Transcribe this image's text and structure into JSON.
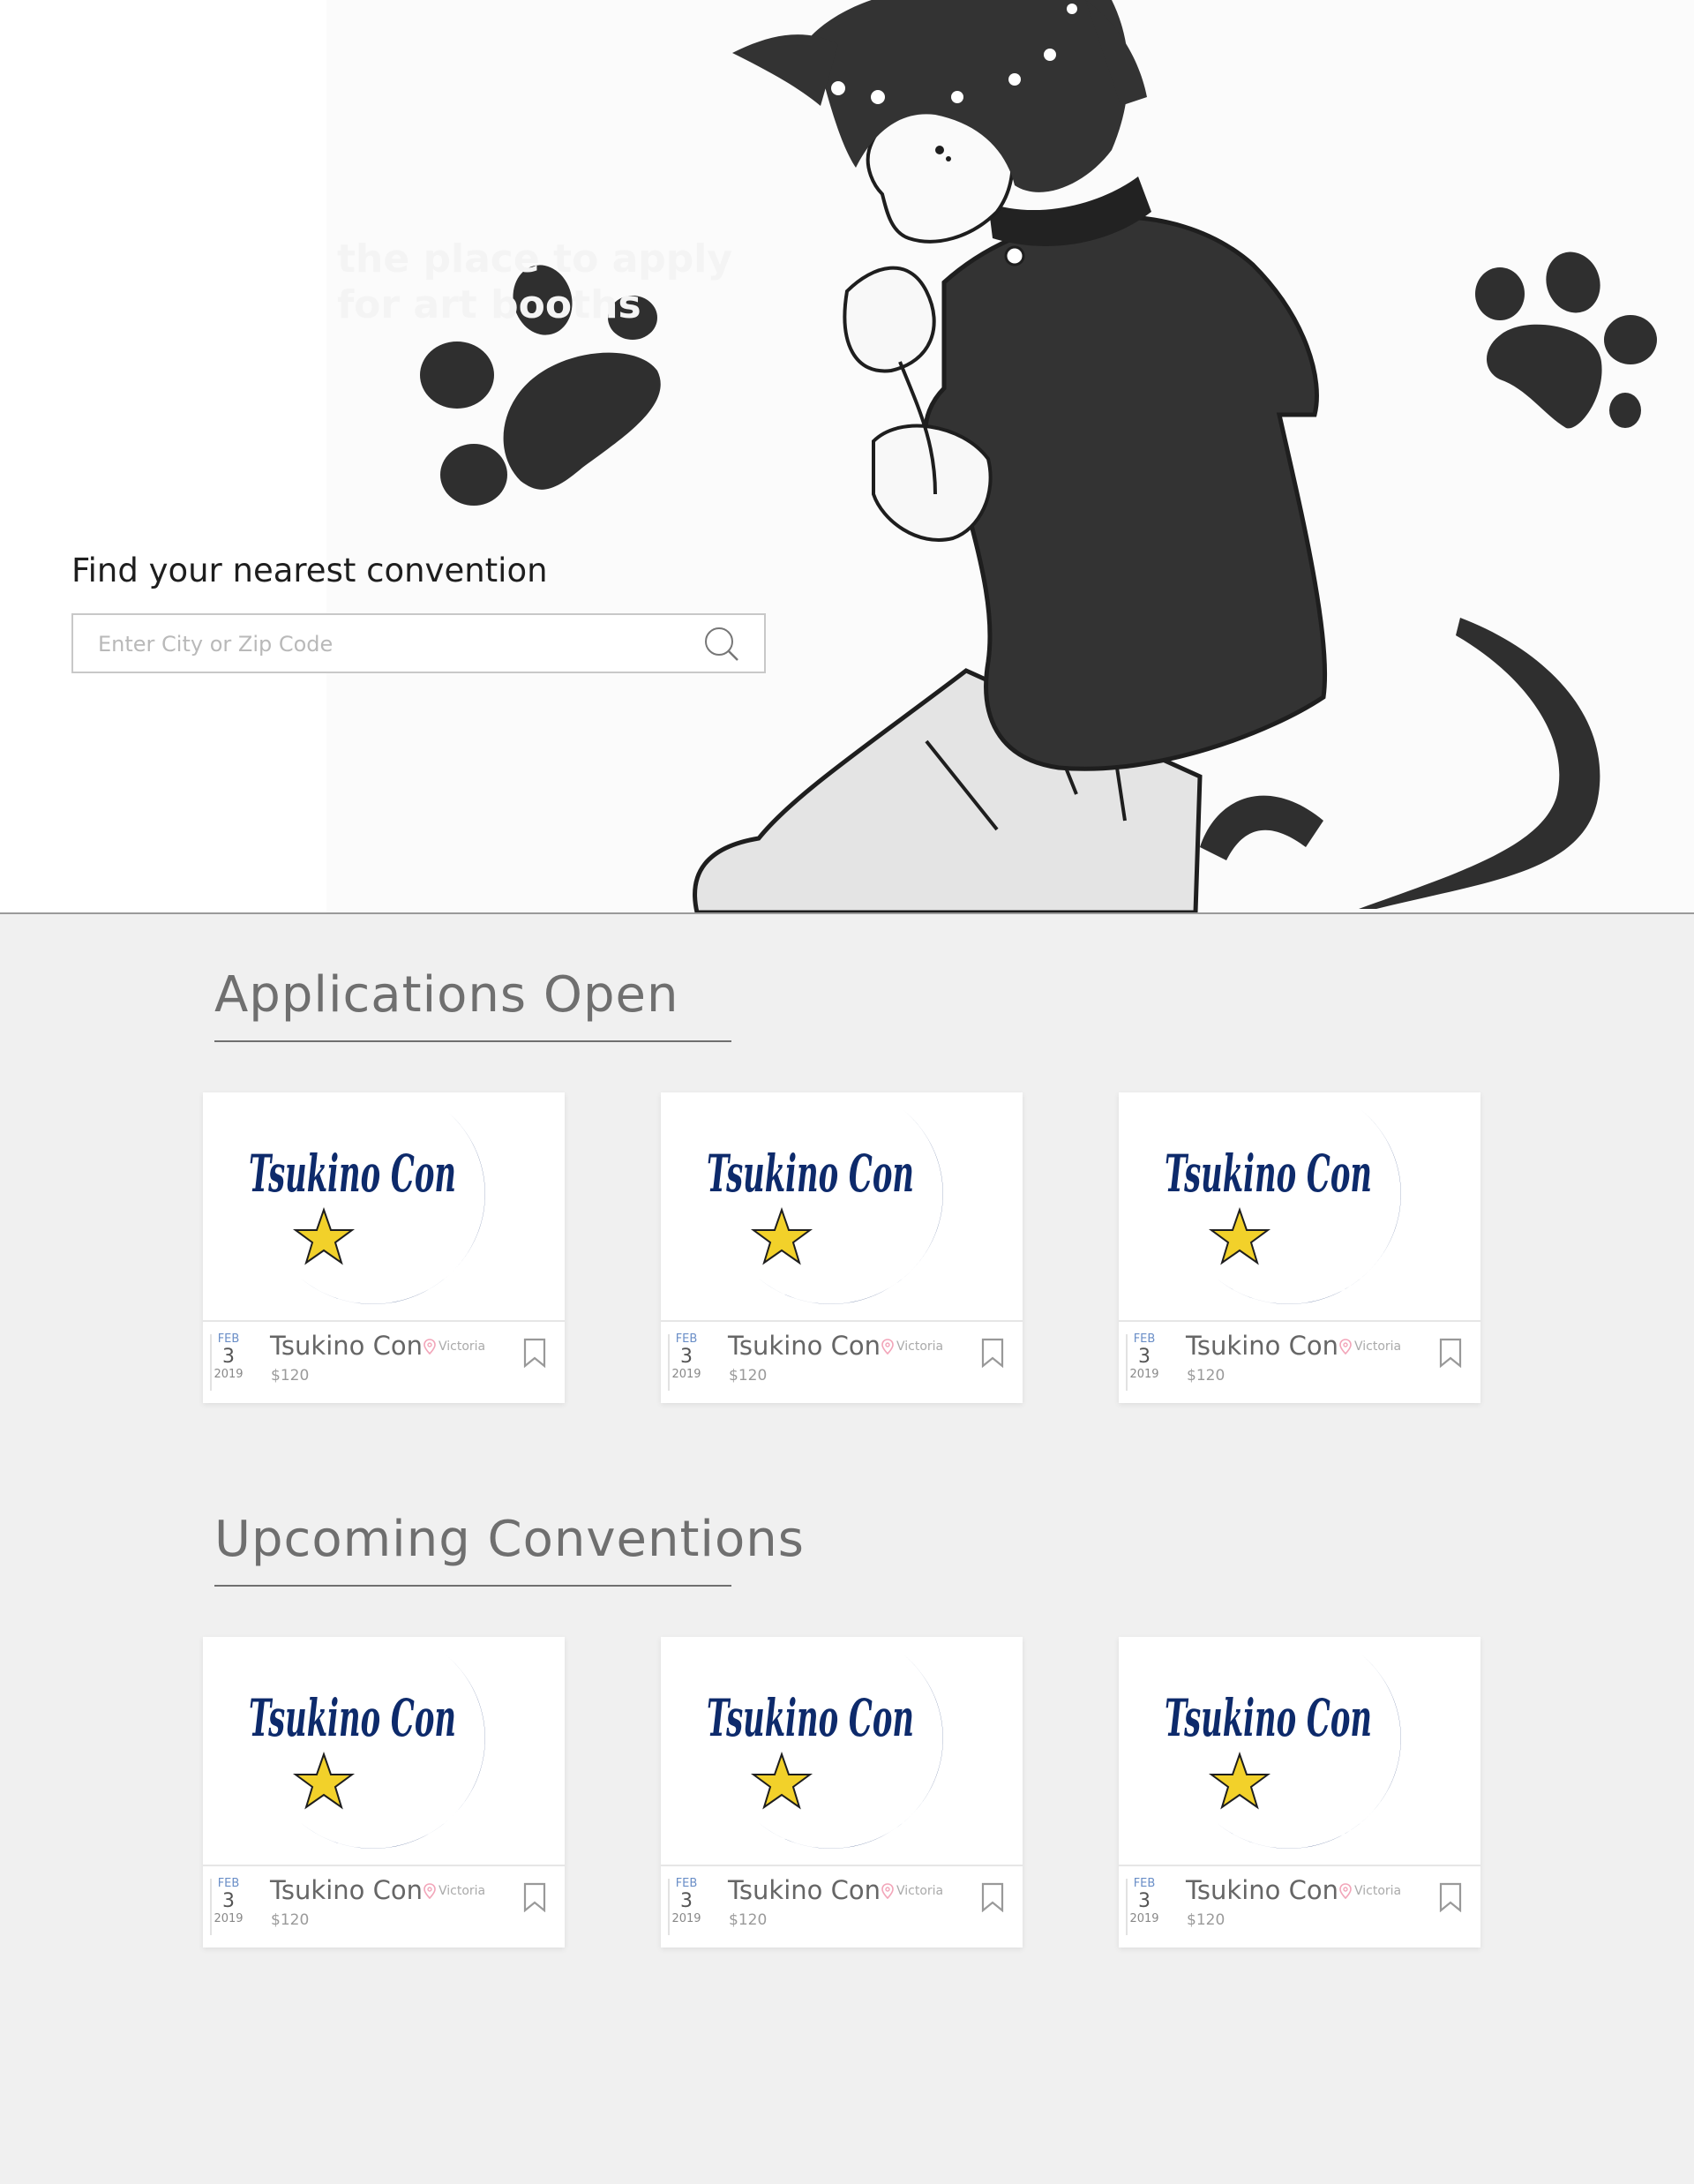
{
  "hero": {
    "faint_text": "the place to apply for art booths",
    "finder_label": "Find your nearest convention",
    "search_placeholder": "Enter City or Zip Code"
  },
  "sections": [
    {
      "title": "Applications Open",
      "cards": [
        {
          "logo": "Tsukino Con",
          "month": "FEB",
          "day": "3",
          "year": "2019",
          "name": "Tsukino Con",
          "location": "Victoria",
          "price": "$120"
        },
        {
          "logo": "Tsukino Con",
          "month": "FEB",
          "day": "3",
          "year": "2019",
          "name": "Tsukino Con",
          "location": "Victoria",
          "price": "$120"
        },
        {
          "logo": "Tsukino Con",
          "month": "FEB",
          "day": "3",
          "year": "2019",
          "name": "Tsukino Con",
          "location": "Victoria",
          "price": "$120"
        }
      ]
    },
    {
      "title": "Upcoming Conventions",
      "cards": [
        {
          "logo": "Tsukino Con",
          "month": "FEB",
          "day": "3",
          "year": "2019",
          "name": "Tsukino Con",
          "location": "Victoria",
          "price": "$120"
        },
        {
          "logo": "Tsukino Con",
          "month": "FEB",
          "day": "3",
          "year": "2019",
          "name": "Tsukino Con",
          "location": "Victoria",
          "price": "$120"
        },
        {
          "logo": "Tsukino Con",
          "month": "FEB",
          "day": "3",
          "year": "2019",
          "name": "Tsukino Con",
          "location": "Victoria",
          "price": "$120"
        }
      ]
    }
  ],
  "colors": {
    "logo_blue": "#0d2a6b",
    "logo_star": "#f2d12a",
    "ink": "#333333",
    "page_bg": "#f0f0f0"
  }
}
